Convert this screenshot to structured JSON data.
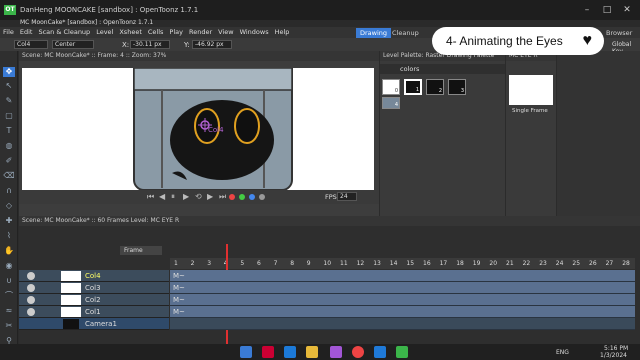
{
  "window": {
    "title": "DanHeng MOONCAKE [sandbox] : OpenToonz 1.7.1",
    "app_title": "MC MoonCake* [sandbox] : OpenToonz 1.7.1"
  },
  "menu": [
    "File",
    "Edit",
    "Scan & Cleanup",
    "Level",
    "Xsheet",
    "Cells",
    "Play",
    "Render",
    "View",
    "Windows",
    "Help"
  ],
  "rooms": [
    "Drawing",
    "Cleanup",
    "Browser"
  ],
  "rooms_extra": "Global Key",
  "toolbar": {
    "object": "Col4",
    "center": "Center",
    "x_label": "X:",
    "x_value": "-30.11 px",
    "y_label": "Y:",
    "y_value": "-46.92 px"
  },
  "viewer": {
    "header": "Scene: MC MoonCake* :: Frame: 4 :: Zoom: 37%",
    "column_label": "Col4",
    "fps_label": "FPS",
    "fps_value": "24"
  },
  "palette": {
    "header": "Level Palette: Raster Drawing Palette",
    "name": "colors",
    "chips": [
      "0",
      "1",
      "2",
      "3",
      "4"
    ]
  },
  "flipbook": {
    "header": "MC EYE R",
    "label": "Single Frame"
  },
  "banner": {
    "text": "4- Animating the Eyes"
  },
  "xsheet": {
    "header": "Scene: MC MoonCake*  ::  60 Frames  Level: MC EYE R",
    "frame_label": "Frame",
    "frames": [
      "1",
      "2",
      "3",
      "4",
      "5",
      "6",
      "7",
      "8",
      "9",
      "10",
      "11",
      "12",
      "13",
      "14",
      "15",
      "16",
      "17",
      "18",
      "19",
      "20",
      "21",
      "22",
      "23",
      "24",
      "25",
      "26",
      "27",
      "28"
    ],
    "current_frame": 4,
    "layers": [
      {
        "name": "Col4",
        "cell": "M~"
      },
      {
        "name": "Col3",
        "cell": "M~"
      },
      {
        "name": "Col2",
        "cell": "M~"
      },
      {
        "name": "Col1",
        "cell": "M~"
      },
      {
        "name": "Camera1",
        "cell": ""
      }
    ]
  },
  "taskbar": {
    "lang": "ENG",
    "time": "5:16 PM",
    "date": "1/3/2024"
  },
  "colors": {
    "accent": "#3a7bd5",
    "cell": "#5a7090",
    "current_frame": "#e03030",
    "eye_ring": "#e0a020"
  }
}
